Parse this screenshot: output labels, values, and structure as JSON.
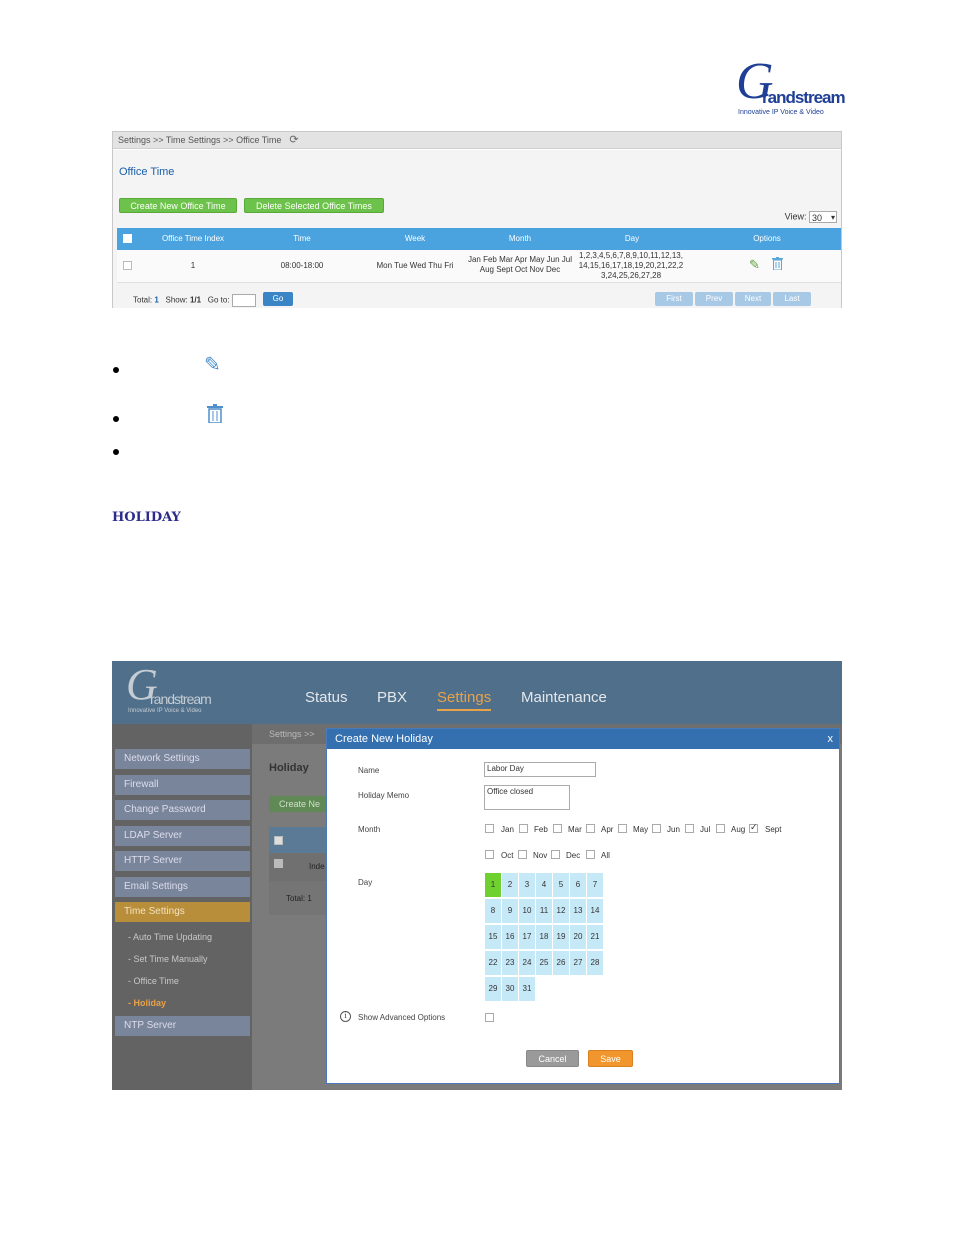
{
  "logo": {
    "brand_initial": "G",
    "brand_word": "randstream",
    "tagline": "Innovative IP Voice & Video"
  },
  "office_time": {
    "breadcrumb": "Settings >> Time Settings >> Office Time",
    "title": "Office Time",
    "buttons": {
      "create": "Create New Office Time",
      "delete": "Delete Selected Office Times"
    },
    "view_label": "View:",
    "view_value": "30",
    "columns": [
      "Office Time Index",
      "Time",
      "Week",
      "Month",
      "Day",
      "Options"
    ],
    "row": {
      "index": "1",
      "time": "08:00-18:00",
      "week": "Mon Tue Wed Thu Fri",
      "month_line1": "Jan Feb Mar Apr May Jun Jul",
      "month_line2": "Aug Sept Oct Nov Dec",
      "day_line1": "1,2,3,4,5,6,7,8,9,10,11,12,13,",
      "day_line2": "14,15,16,17,18,19,20,21,22,2",
      "day_line3": "3,24,25,26,27,28"
    },
    "footer": {
      "total_label": "Total:",
      "total": "1",
      "show_label": "Show:",
      "show": "1/1",
      "goto_label": "Go to:",
      "go": "Go"
    },
    "pager": [
      "First",
      "Prev",
      "Next",
      "Last"
    ]
  },
  "section_heading": "HOLIDAY",
  "holiday_ui": {
    "logo": {
      "brand_initial": "G",
      "brand_word": "randstream",
      "tagline": "Innovative IP Voice & Video"
    },
    "nav": [
      "Status",
      "PBX",
      "Settings",
      "Maintenance"
    ],
    "sidebar": [
      "Network Settings",
      "Firewall",
      "Change Password",
      "LDAP Server",
      "HTTP Server",
      "Email Settings",
      "Time Settings"
    ],
    "subitems": [
      "- Auto Time Updating",
      "- Set Time Manually",
      "- Office Time",
      "- Holiday"
    ],
    "sidebar_after": "NTP Server",
    "breadcrumb": "Settings >>",
    "page_title": "Holiday",
    "create_btn_fragment": "Create Ne",
    "row_fragment": "Inde",
    "total_fragment": "Total: 1",
    "modal": {
      "title": "Create New Holiday",
      "close": "x",
      "name_label": "Name",
      "name_value": "Labor Day",
      "memo_label": "Holiday Memo",
      "memo_value": "Office closed",
      "month_label": "Month",
      "months_row1": [
        "Jan",
        "Feb",
        "Mar",
        "Apr",
        "May",
        "Jun",
        "Jul",
        "Aug",
        "Sept"
      ],
      "months_row2": [
        "Oct",
        "Nov",
        "Dec",
        "All"
      ],
      "checked_month": "Sept",
      "day_label": "Day",
      "selected_day": "1",
      "advanced_label": "Show Advanced Options",
      "cancel": "Cancel",
      "save": "Save"
    }
  }
}
